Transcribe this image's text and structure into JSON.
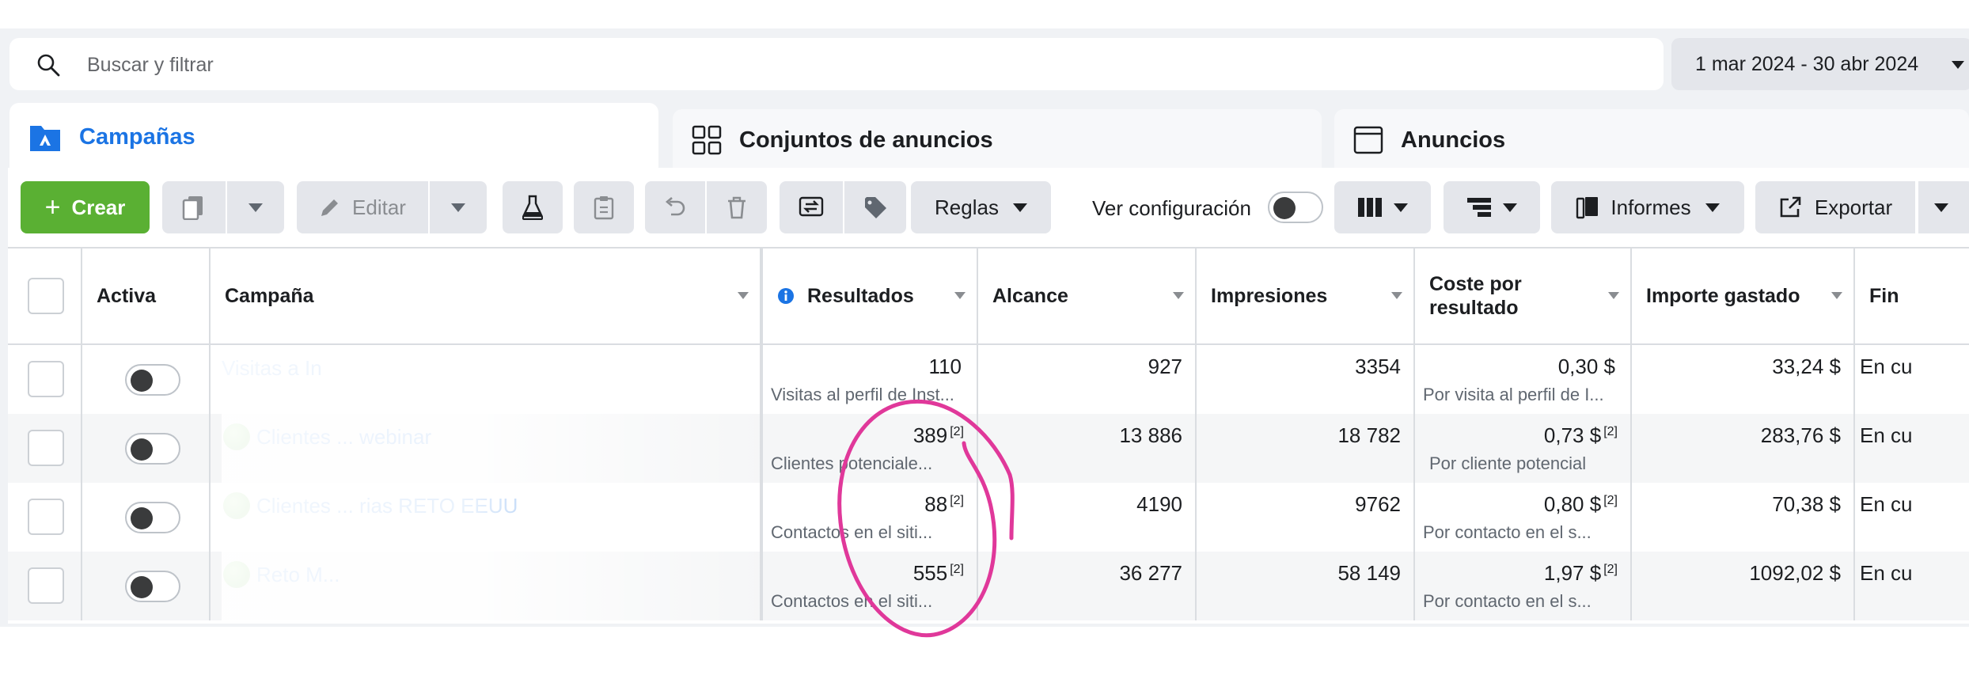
{
  "search": {
    "placeholder": "Buscar y filtrar"
  },
  "date_range": "1 mar 2024 - 30 abr 2024",
  "tabs": [
    {
      "label": "Campañas",
      "active": true
    },
    {
      "label": "Conjuntos de anuncios",
      "active": false
    },
    {
      "label": "Anuncios",
      "active": false
    }
  ],
  "toolbar": {
    "create": "Crear",
    "edit": "Editar",
    "rules": "Reglas",
    "view_settings": "Ver configuración",
    "reports": "Informes",
    "export": "Exportar"
  },
  "columns": {
    "active": "Activa",
    "campaign": "Campaña",
    "results": "Resultados",
    "reach": "Alcance",
    "impressions": "Impresiones",
    "cost_per_result": "Coste por resultado",
    "amount_spent": "Importe gastado",
    "end": "Fin"
  },
  "rows": [
    {
      "name": "Visitas a In",
      "results": "110",
      "results_note": "",
      "results_sub": "Visitas al perfil de Inst...",
      "reach": "927",
      "impressions": "3354",
      "cpr": "0,30 $",
      "cpr_note": "",
      "cpr_sub": "Por visita al perfil de I...",
      "spent": "33,24 $",
      "end": "En cu"
    },
    {
      "name": "Clientes ... webinar",
      "results": "389",
      "results_note": "[2]",
      "results_sub": "Clientes potenciale...",
      "reach": "13 886",
      "impressions": "18 782",
      "cpr": "0,73 $",
      "cpr_note": "[2]",
      "cpr_sub": "Por cliente potencial",
      "spent": "283,76 $",
      "end": "En cu"
    },
    {
      "name": "Clientes ... rias RETO EEUU",
      "results": "88",
      "results_note": "[2]",
      "results_sub": "Contactos en el siti...",
      "reach": "4190",
      "impressions": "9762",
      "cpr": "0,80 $",
      "cpr_note": "[2]",
      "cpr_sub": "Por contacto en el s...",
      "spent": "70,38 $",
      "end": "En cu"
    },
    {
      "name": "Reto M...",
      "results": "555",
      "results_note": "[2]",
      "results_sub": "Contactos en el siti...",
      "reach": "36 277",
      "impressions": "58 149",
      "cpr": "1,97 $",
      "cpr_note": "[2]",
      "cpr_sub": "Por contacto en el s...",
      "spent": "1092,02 $",
      "end": "En cu"
    }
  ],
  "colors": {
    "accent": "#1b74e4",
    "create": "#5ab033",
    "annotation": "#e0389a"
  }
}
